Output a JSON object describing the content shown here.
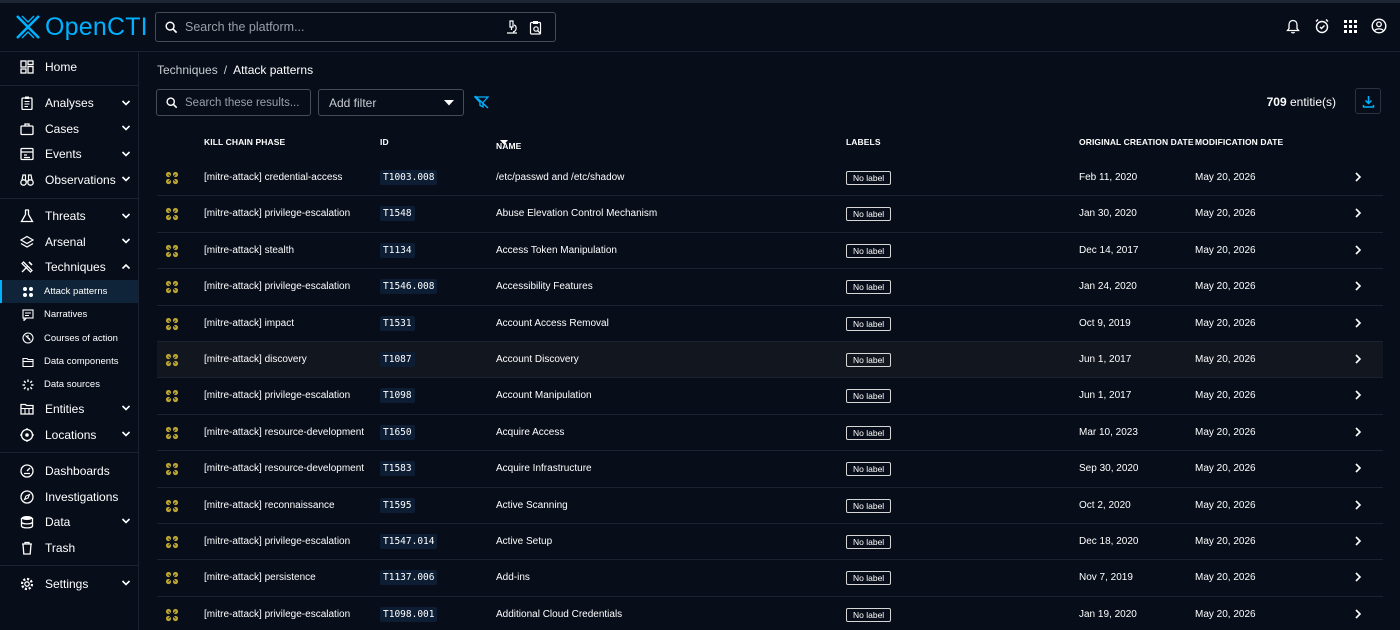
{
  "app": {
    "name": "OpenCTI"
  },
  "search": {
    "placeholder": "Search the platform..."
  },
  "sidebar": {
    "items": [
      {
        "label": "Home",
        "icon": "home-icon"
      },
      {
        "label": "Analyses",
        "icon": "clipboard-icon",
        "expandable": true
      },
      {
        "label": "Cases",
        "icon": "briefcase-icon",
        "expandable": true
      },
      {
        "label": "Events",
        "icon": "events-icon",
        "expandable": true
      },
      {
        "label": "Observations",
        "icon": "binoculars-icon",
        "expandable": true
      },
      {
        "label": "Threats",
        "icon": "flask-icon",
        "expandable": true
      },
      {
        "label": "Arsenal",
        "icon": "layers-icon",
        "expandable": true
      },
      {
        "label": "Techniques",
        "icon": "tools-icon",
        "expandable": true,
        "expanded": true
      },
      {
        "label": "Entities",
        "icon": "folder-table-icon",
        "expandable": true
      },
      {
        "label": "Locations",
        "icon": "location-icon",
        "expandable": true
      },
      {
        "label": "Dashboards",
        "icon": "dashboard-icon"
      },
      {
        "label": "Investigations",
        "icon": "compass-icon"
      },
      {
        "label": "Data",
        "icon": "database-icon",
        "expandable": true
      },
      {
        "label": "Trash",
        "icon": "trash-icon"
      },
      {
        "label": "Settings",
        "icon": "gear-icon",
        "expandable": true
      }
    ],
    "technique_subitems": [
      {
        "label": "Attack patterns",
        "icon": "attack-pattern-icon",
        "active": true
      },
      {
        "label": "Narratives",
        "icon": "narrative-icon"
      },
      {
        "label": "Courses of action",
        "icon": "course-of-action-icon"
      },
      {
        "label": "Data components",
        "icon": "data-component-icon"
      },
      {
        "label": "Data sources",
        "icon": "data-source-icon"
      }
    ]
  },
  "breadcrumb": {
    "parent": "Techniques",
    "separator": "/",
    "current": "Attack patterns"
  },
  "toolbar": {
    "search_placeholder": "Search these results...",
    "add_filter": "Add filter",
    "count_number": "709",
    "count_suffix": " entitie(s)"
  },
  "table": {
    "headers": {
      "kill_chain": "KILL CHAIN PHASE",
      "id": "ID",
      "name": "NAME",
      "labels": "LABELS",
      "created": "ORIGINAL CREATION DATE",
      "modified": "MODIFICATION DATE"
    },
    "rows": [
      {
        "phase": "[mitre-attack] credential-access",
        "id": "T1003.008",
        "name": "/etc/passwd and /etc/shadow",
        "label": "No label",
        "created": "Feb 11, 2020",
        "modified": "May 20, 2026"
      },
      {
        "phase": "[mitre-attack] privilege-escalation",
        "id": "T1548",
        "name": "Abuse Elevation Control Mechanism",
        "label": "No label",
        "created": "Jan 30, 2020",
        "modified": "May 20, 2026"
      },
      {
        "phase": "[mitre-attack] stealth",
        "id": "T1134",
        "name": "Access Token Manipulation",
        "label": "No label",
        "created": "Dec 14, 2017",
        "modified": "May 20, 2026"
      },
      {
        "phase": "[mitre-attack] privilege-escalation",
        "id": "T1546.008",
        "name": "Accessibility Features",
        "label": "No label",
        "created": "Jan 24, 2020",
        "modified": "May 20, 2026"
      },
      {
        "phase": "[mitre-attack] impact",
        "id": "T1531",
        "name": "Account Access Removal",
        "label": "No label",
        "created": "Oct 9, 2019",
        "modified": "May 20, 2026"
      },
      {
        "phase": "[mitre-attack] discovery",
        "id": "T1087",
        "name": "Account Discovery",
        "label": "No label",
        "created": "Jun 1, 2017",
        "modified": "May 20, 2026"
      },
      {
        "phase": "[mitre-attack] privilege-escalation",
        "id": "T1098",
        "name": "Account Manipulation",
        "label": "No label",
        "created": "Jun 1, 2017",
        "modified": "May 20, 2026"
      },
      {
        "phase": "[mitre-attack] resource-development",
        "id": "T1650",
        "name": "Acquire Access",
        "label": "No label",
        "created": "Mar 10, 2023",
        "modified": "May 20, 2026"
      },
      {
        "phase": "[mitre-attack] resource-development",
        "id": "T1583",
        "name": "Acquire Infrastructure",
        "label": "No label",
        "created": "Sep 30, 2020",
        "modified": "May 20, 2026"
      },
      {
        "phase": "[mitre-attack] reconnaissance",
        "id": "T1595",
        "name": "Active Scanning",
        "label": "No label",
        "created": "Oct 2, 2020",
        "modified": "May 20, 2026"
      },
      {
        "phase": "[mitre-attack] privilege-escalation",
        "id": "T1547.014",
        "name": "Active Setup",
        "label": "No label",
        "created": "Dec 18, 2020",
        "modified": "May 20, 2026"
      },
      {
        "phase": "[mitre-attack] persistence",
        "id": "T1137.006",
        "name": "Add-ins",
        "label": "No label",
        "created": "Nov 7, 2019",
        "modified": "May 20, 2026"
      },
      {
        "phase": "[mitre-attack] privilege-escalation",
        "id": "T1098.001",
        "name": "Additional Cloud Credentials",
        "label": "No label",
        "created": "Jan 19, 2020",
        "modified": "May 20, 2026"
      }
    ]
  },
  "colors": {
    "accent": "#00b1ff",
    "attack_pattern_icon": "#b8a333",
    "background": "#070d19"
  }
}
